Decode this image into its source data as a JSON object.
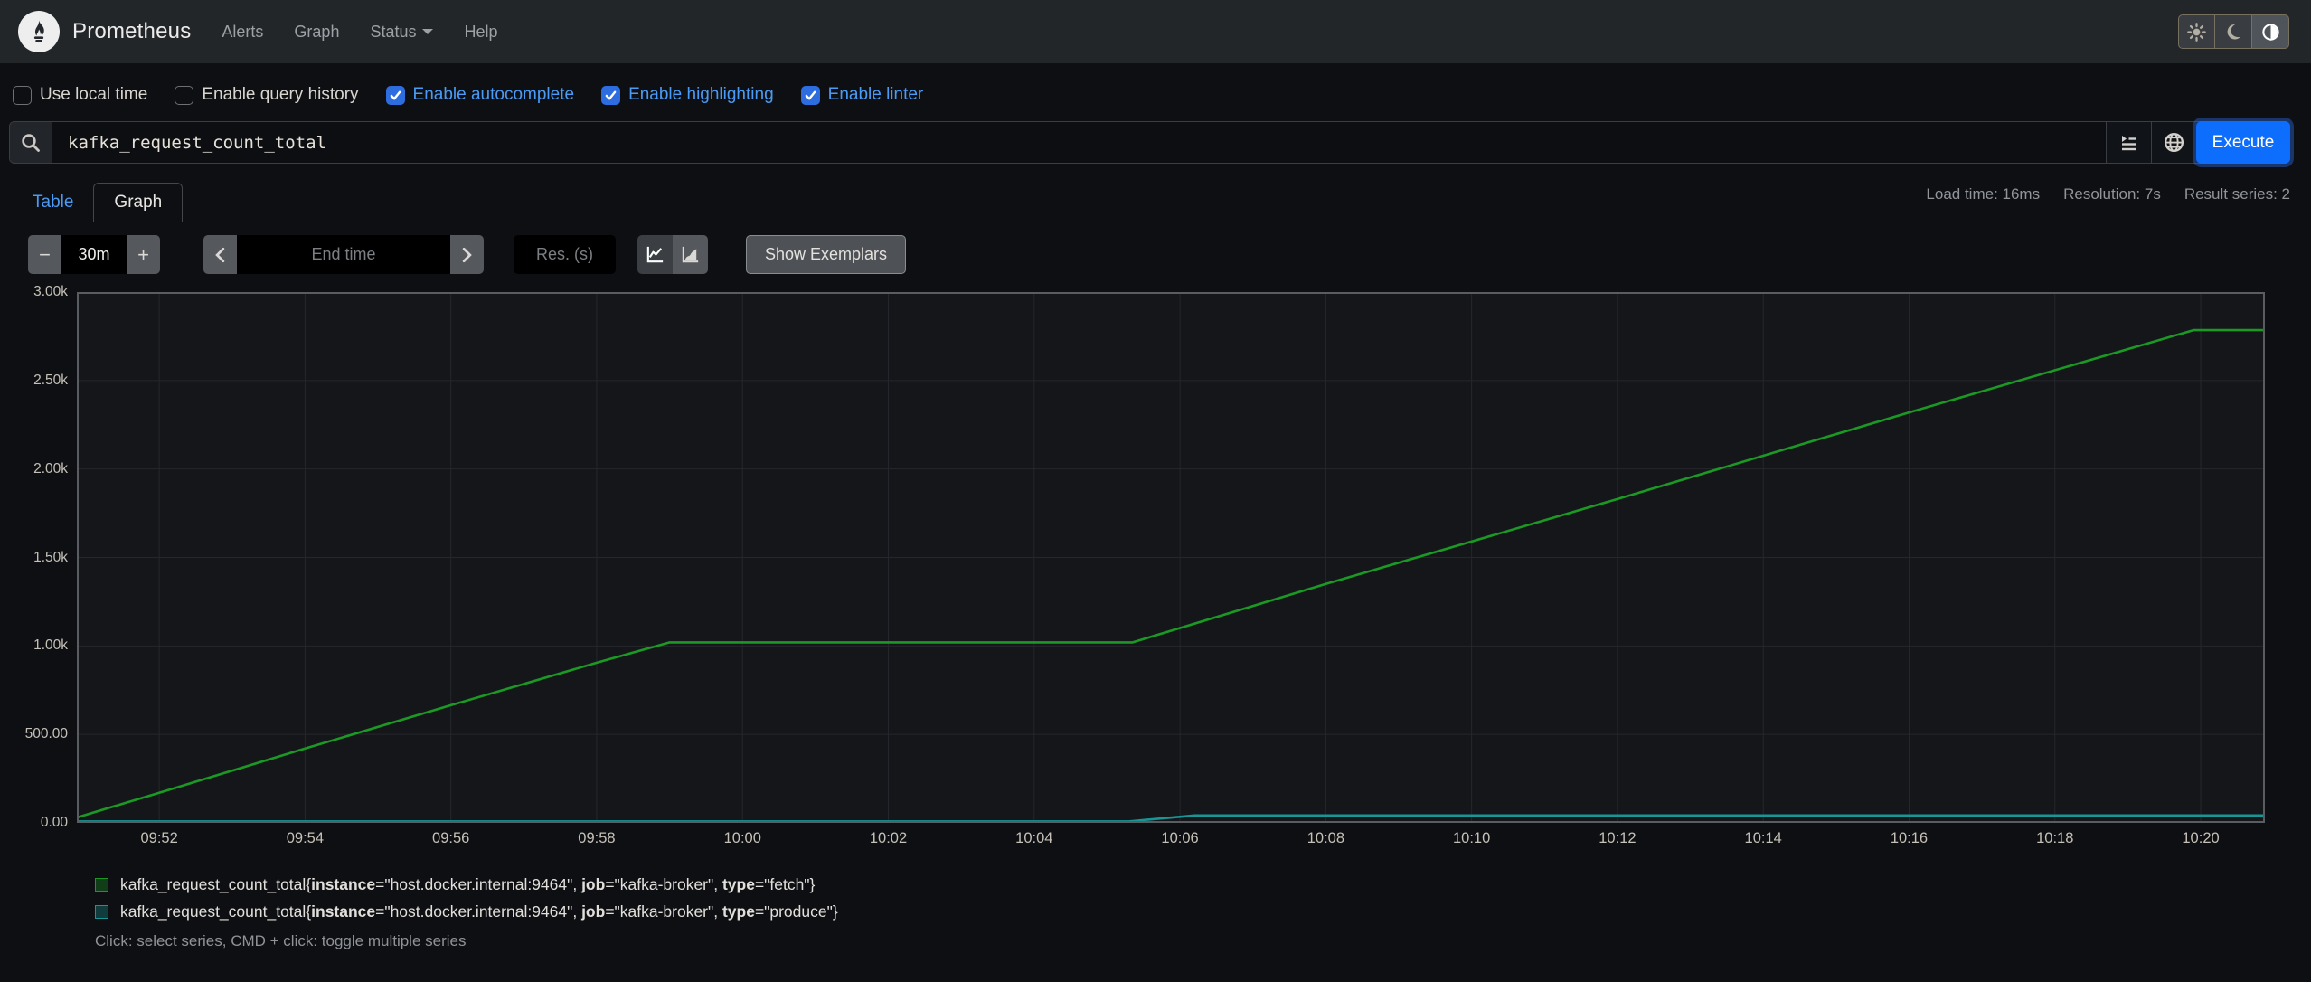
{
  "navbar": {
    "brand": "Prometheus",
    "items": [
      {
        "label": "Alerts",
        "caret": false
      },
      {
        "label": "Graph",
        "caret": false
      },
      {
        "label": "Status",
        "caret": true
      },
      {
        "label": "Help",
        "caret": false
      }
    ],
    "theme_buttons": [
      {
        "name": "light",
        "active": false
      },
      {
        "name": "dark",
        "active": false
      },
      {
        "name": "auto",
        "active": true
      }
    ]
  },
  "options": {
    "checkboxes": [
      {
        "label": "Use local time",
        "checked": false
      },
      {
        "label": "Enable query history",
        "checked": false
      },
      {
        "label": "Enable autocomplete",
        "checked": true
      },
      {
        "label": "Enable highlighting",
        "checked": true
      },
      {
        "label": "Enable linter",
        "checked": true
      }
    ]
  },
  "query": {
    "value": "kafka_request_count_total",
    "execute_label": "Execute"
  },
  "tabs": {
    "table": "Table",
    "graph": "Graph"
  },
  "stats": {
    "load_time": "Load time: 16ms",
    "resolution": "Resolution: 7s",
    "result_series": "Result series: 2"
  },
  "controls": {
    "minus": "−",
    "duration": "30m",
    "plus": "+",
    "end_time_placeholder": "End time",
    "res_placeholder": "Res. (s)",
    "show_exemplars": "Show Exemplars"
  },
  "chart_data": {
    "type": "line",
    "grid": true,
    "x_axis": {
      "tick_labels": [
        "09:52",
        "09:54",
        "09:56",
        "09:58",
        "10:00",
        "10:02",
        "10:04",
        "10:06",
        "10:08",
        "10:10",
        "10:12",
        "10:14",
        "10:16",
        "10:18",
        "10:20"
      ],
      "tick_minutes": [
        0,
        2,
        4,
        6,
        8,
        10,
        12,
        14,
        16,
        18,
        20,
        22,
        24,
        26,
        28
      ],
      "range_minutes": [
        -1.13,
        28.88
      ]
    },
    "y_axis": {
      "tick_labels": [
        "0.00",
        "500.00",
        "1.00k",
        "1.50k",
        "2.00k",
        "2.50k",
        "3.00k"
      ],
      "tick_values": [
        0,
        500,
        1000,
        1500,
        2000,
        2500,
        3000
      ],
      "range": [
        0,
        3000
      ]
    },
    "series": [
      {
        "color": "#1b9924",
        "label_parts": {
          "metric": "kafka_request_count_total",
          "labels": [
            {
              "k": "instance",
              "v": "host.docker.internal:9464"
            },
            {
              "k": "job",
              "v": "kafka-broker"
            },
            {
              "k": "type",
              "v": "fetch"
            }
          ]
        },
        "points": [
          [
            -1.13,
            30
          ],
          [
            0,
            170
          ],
          [
            2,
            420
          ],
          [
            4,
            665
          ],
          [
            6,
            905
          ],
          [
            7.0,
            1020
          ],
          [
            13.35,
            1020
          ],
          [
            16,
            1350
          ],
          [
            20,
            1830
          ],
          [
            24,
            2320
          ],
          [
            27.9,
            2785
          ],
          [
            28.88,
            2785
          ]
        ]
      },
      {
        "color": "#179696",
        "label_parts": {
          "metric": "kafka_request_count_total",
          "labels": [
            {
              "k": "instance",
              "v": "host.docker.internal:9464"
            },
            {
              "k": "job",
              "v": "kafka-broker"
            },
            {
              "k": "type",
              "v": "produce"
            }
          ]
        },
        "points": [
          [
            -1.13,
            8
          ],
          [
            13.3,
            8
          ],
          [
            14.2,
            42
          ],
          [
            28.88,
            42
          ]
        ]
      }
    ],
    "colors": {
      "plot_bg": "#14161a",
      "grid": "#24272c",
      "border": "#595d61"
    }
  },
  "footer": {
    "hint": "Click: select series, CMD + click: toggle multiple series"
  }
}
